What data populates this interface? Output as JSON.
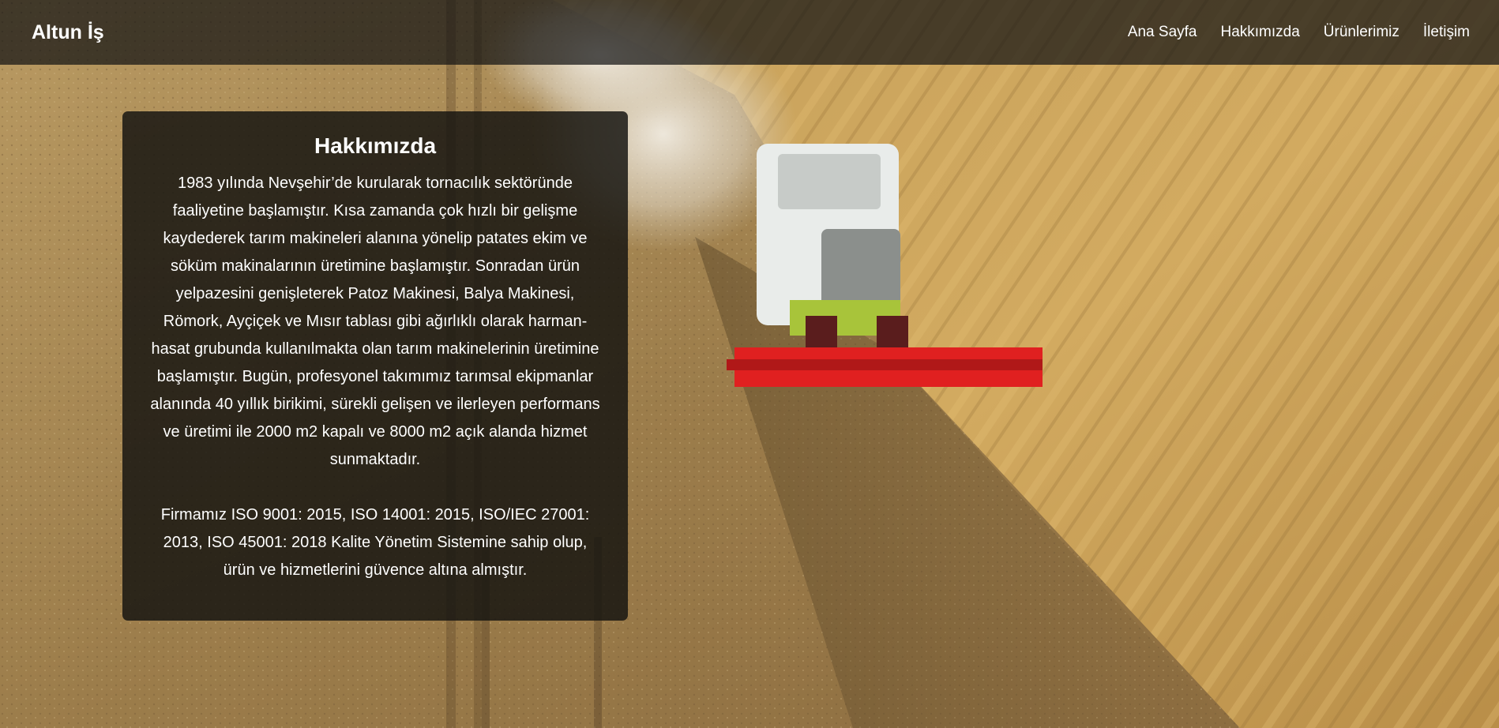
{
  "navbar": {
    "brand": "Altun İş",
    "links": [
      "Ana Sayfa",
      "Hakkımızda",
      "Ürünlerimiz",
      "İletişim"
    ]
  },
  "about": {
    "title": "Hakkımızda",
    "paragraphs": [
      "1983 yılında Nevşehir’de kurularak tornacılık sektöründe faaliyetine başlamıştır. Kısa zamanda çok hızlı bir gelişme kaydederek tarım makineleri alanına yönelip patates ekim ve söküm makinalarının üretimine başlamıştır. Sonradan ürün yelpazesini genişleterek Patoz Makinesi, Balya Makinesi, Römork, Ayçiçek ve Mısır tablası gibi ağırlıklı olarak harman-hasat grubunda kullanılmakta olan tarım makinelerinin üretimine başlamıştır. Bugün, profesyonel takımımız tarımsal ekipmanlar alanında 40 yıllık birikimi, sürekli gelişen ve ilerleyen performans ve üretimi ile 2000 m2 kapalı ve 8000 m2 açık alanda hizmet sunmaktadır.",
      "Firmamız ISO 9001: 2015, ISO 14001: 2015, ISO/IEC 27001: 2013, ISO 45001: 2018 Kalite Yönetim Sistemine sahip olup, ürün ve hizmetlerini güvence altına almıştır."
    ]
  },
  "colors": {
    "wheat_light": "#c9a866",
    "wheat_dark": "#8a6c3c",
    "harvester_red": "#e02020",
    "harvester_green": "#a8c43a"
  }
}
